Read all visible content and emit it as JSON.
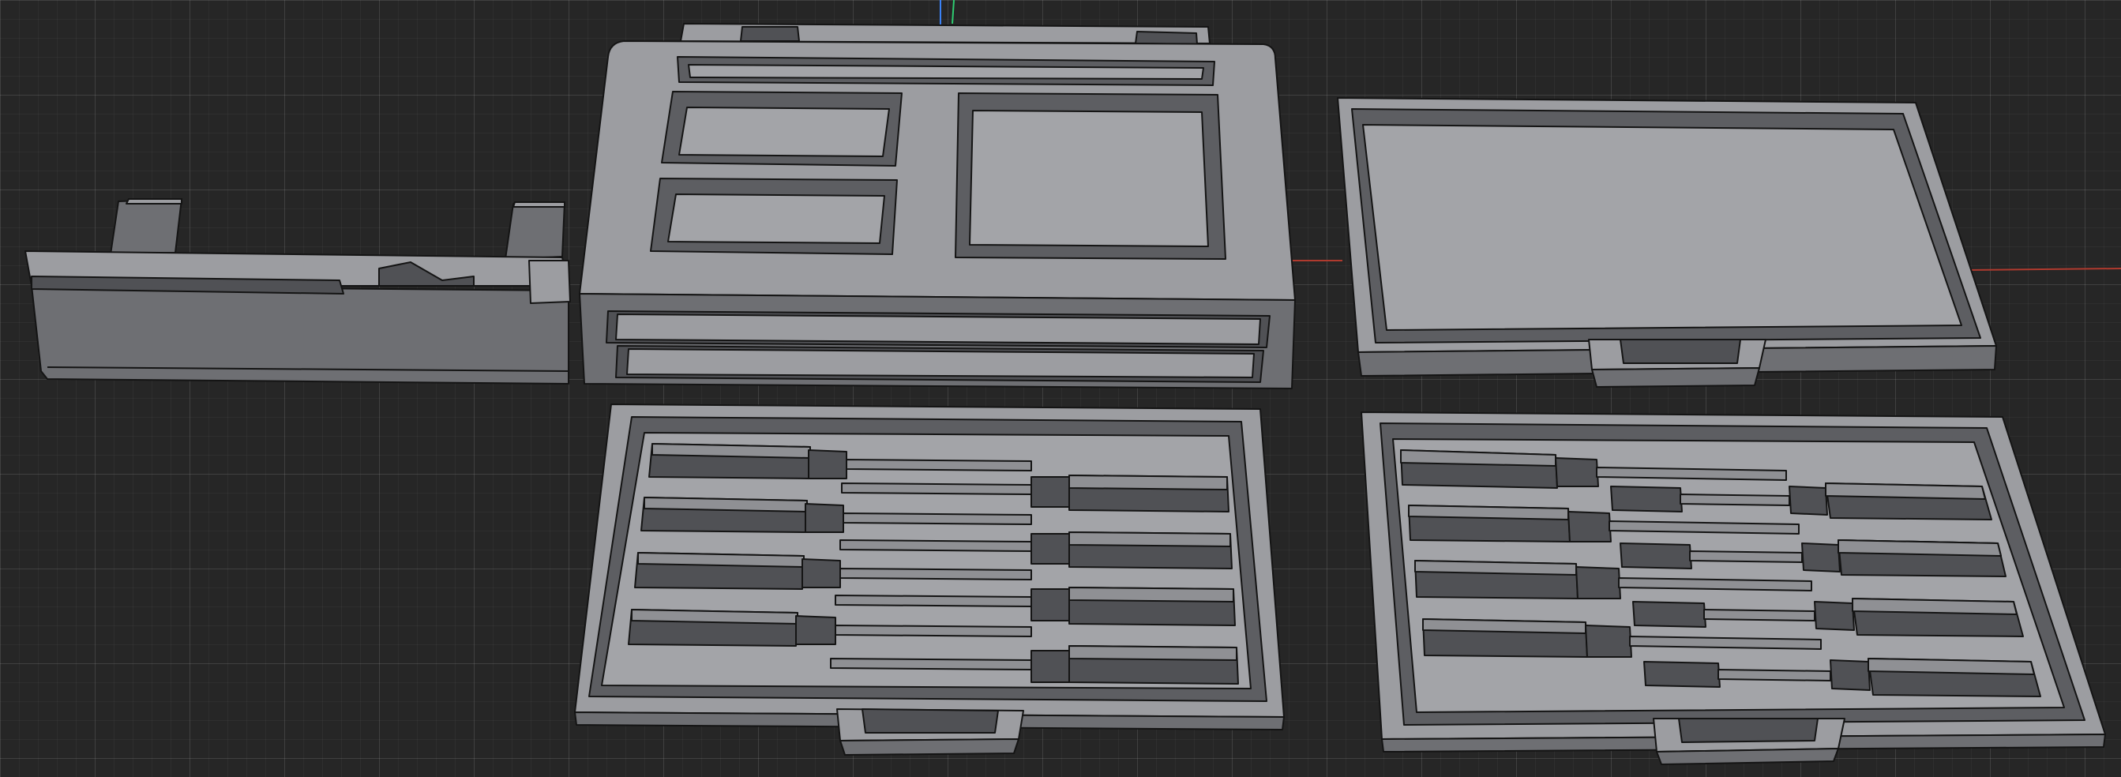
{
  "viewport": {
    "background": "#262626",
    "grid_color": "#3a3a3a",
    "axis_colors": {
      "x": "#c0392b",
      "y": "#2ecc71",
      "z": "#3b82f6"
    },
    "model_color": "#9c9da1",
    "edge_color": "#141414"
  },
  "parts": [
    {
      "id": "side-latch-part"
    },
    {
      "id": "main-box-with-drawers"
    },
    {
      "id": "empty-tray-lid"
    },
    {
      "id": "screwdriver-tray-a",
      "slots": 8
    },
    {
      "id": "screwdriver-tray-b",
      "slots": 8
    }
  ]
}
